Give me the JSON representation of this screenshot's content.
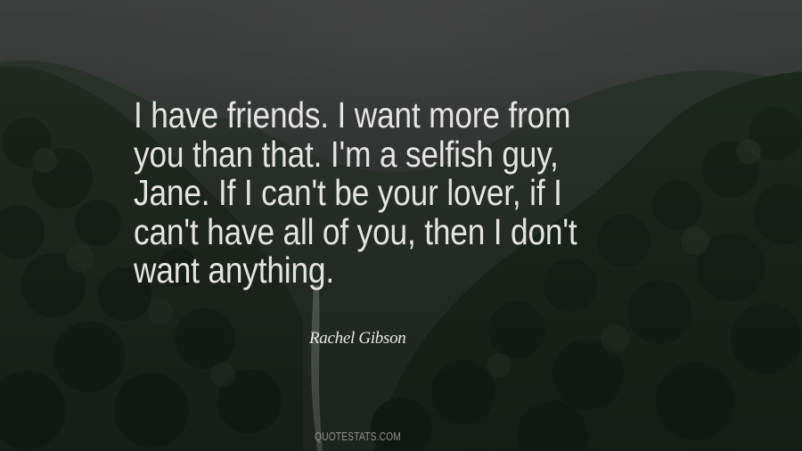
{
  "quote": {
    "lines": [
      "I have friends. I want more from",
      "you than that. I'm a selfish guy,",
      "Jane. If I can't be your lover, if I",
      "can't have all of you, then I don't",
      "want anything."
    ]
  },
  "author": "Rachel Gibson",
  "watermark": "QUOTESTATS.COM",
  "colors": {
    "sky": "#3b3d3c",
    "forest": "#1f2a1f",
    "text": "#e4e4e2"
  }
}
